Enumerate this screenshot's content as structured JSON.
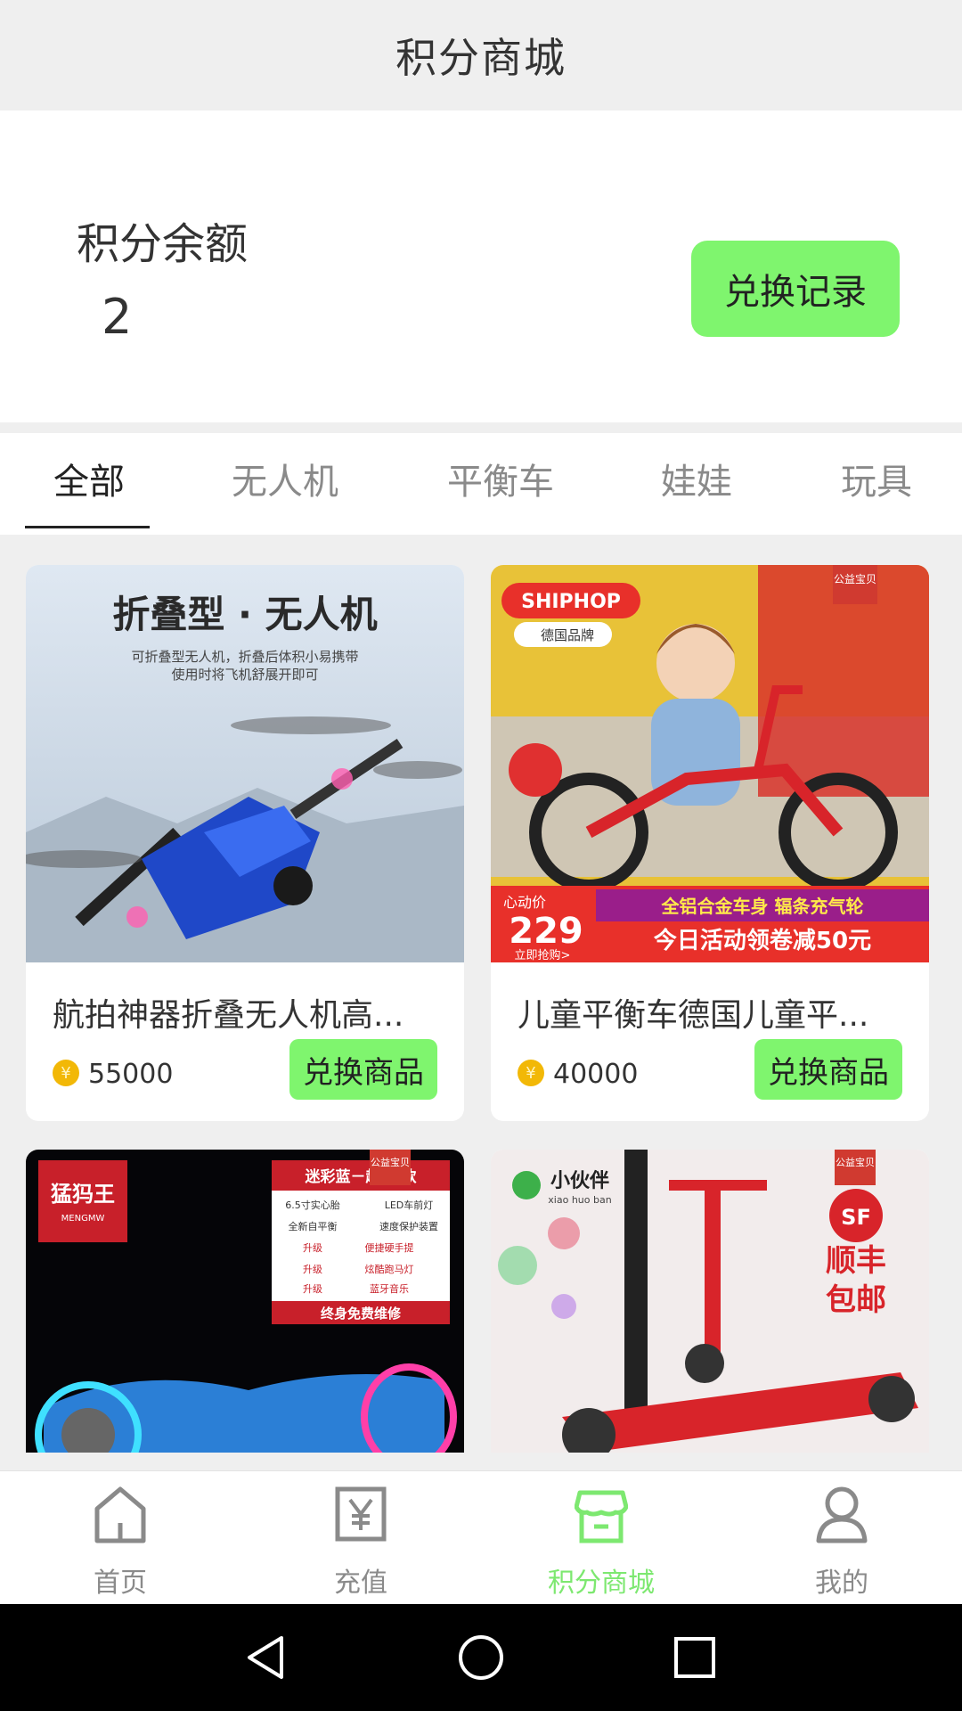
{
  "header": {
    "title": "积分商城"
  },
  "balance": {
    "label": "积分余额",
    "value": "2",
    "record_button": "兑换记录"
  },
  "tabs": [
    {
      "label": "全部",
      "active": true
    },
    {
      "label": "无人机"
    },
    {
      "label": "平衡车"
    },
    {
      "label": "娃娃"
    },
    {
      "label": "玩具"
    }
  ],
  "products": [
    {
      "title": "航拍神器折叠无人机高...",
      "points": "55000",
      "button": "兑换商品",
      "image": {
        "headline": "折叠型 · 无人机",
        "sub1": "可折叠型无人机，折叠后体积小易携带",
        "sub2": "使用时将飞机舒展开即可"
      }
    },
    {
      "title": "儿童平衡车德国儿童平...",
      "points": "40000",
      "button": "兑换商品",
      "image": {
        "brand": "SHIPHOP",
        "brand_sub": "德国品牌",
        "badge": "公益宝贝",
        "price_tag": "心动价",
        "price": "229",
        "banner1": "全铝合金车身 辐条充气轮",
        "banner2": "今日活动领卷减50元",
        "cta": "立即抢购>"
      }
    },
    {
      "image": {
        "brand": "猛犸王",
        "brand_en": "MENGMW",
        "badge": "公益宝贝",
        "headline": "迷彩蓝－超 炫款",
        "spec_rows": [
          "6.5寸实心胎",
          "LED车前灯",
          "全新自平衡",
          "速度保护装置"
        ],
        "upgrades": [
          "便捷硬手提",
          "炫酷跑马灯",
          "蓝牙音乐"
        ],
        "upgrade_label": "升级",
        "footer": "终身免费维修"
      }
    },
    {
      "image": {
        "brand": "小伙伴",
        "brand_en": "xiao huo ban",
        "badge": "公益宝贝",
        "logo": "SF",
        "promo1": "顺丰",
        "promo2": "包邮"
      }
    }
  ],
  "bottom_nav": [
    {
      "label": "首页",
      "icon": "home-icon"
    },
    {
      "label": "充值",
      "icon": "yen-icon"
    },
    {
      "label": "积分商城",
      "icon": "store-icon",
      "active": true
    },
    {
      "label": "我的",
      "icon": "profile-icon"
    }
  ],
  "colors": {
    "accent": "#7ff56e",
    "active_nav": "#7de870",
    "coin": "#f2b807"
  }
}
